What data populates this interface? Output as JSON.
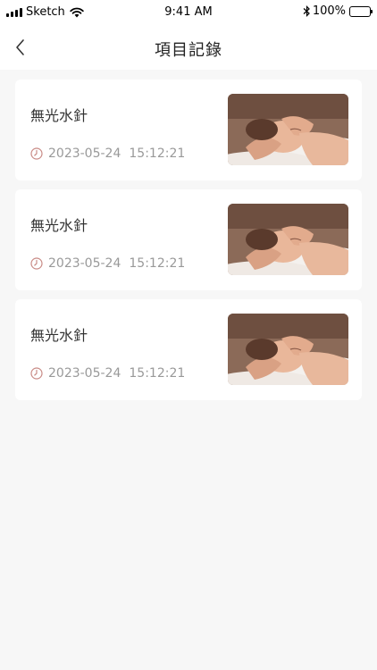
{
  "status_bar": {
    "carrier": "Sketch",
    "time": "9:41 AM",
    "battery": "100%"
  },
  "nav": {
    "title": "項目記錄",
    "back_icon": "chevron-left-icon"
  },
  "records": [
    {
      "title": "無光水針",
      "date": "2023-05-24",
      "time": "15:12:21",
      "image": "facial-massage-photo",
      "clock_color": "#c98b86"
    },
    {
      "title": "無光水針",
      "date": "2023-05-24",
      "time": "15:12:21",
      "image": "facial-massage-photo",
      "clock_color": "#c98b86"
    },
    {
      "title": "無光水針",
      "date": "2023-05-24",
      "time": "15:12:21",
      "image": "facial-massage-photo",
      "clock_color": "#c98b86"
    }
  ]
}
